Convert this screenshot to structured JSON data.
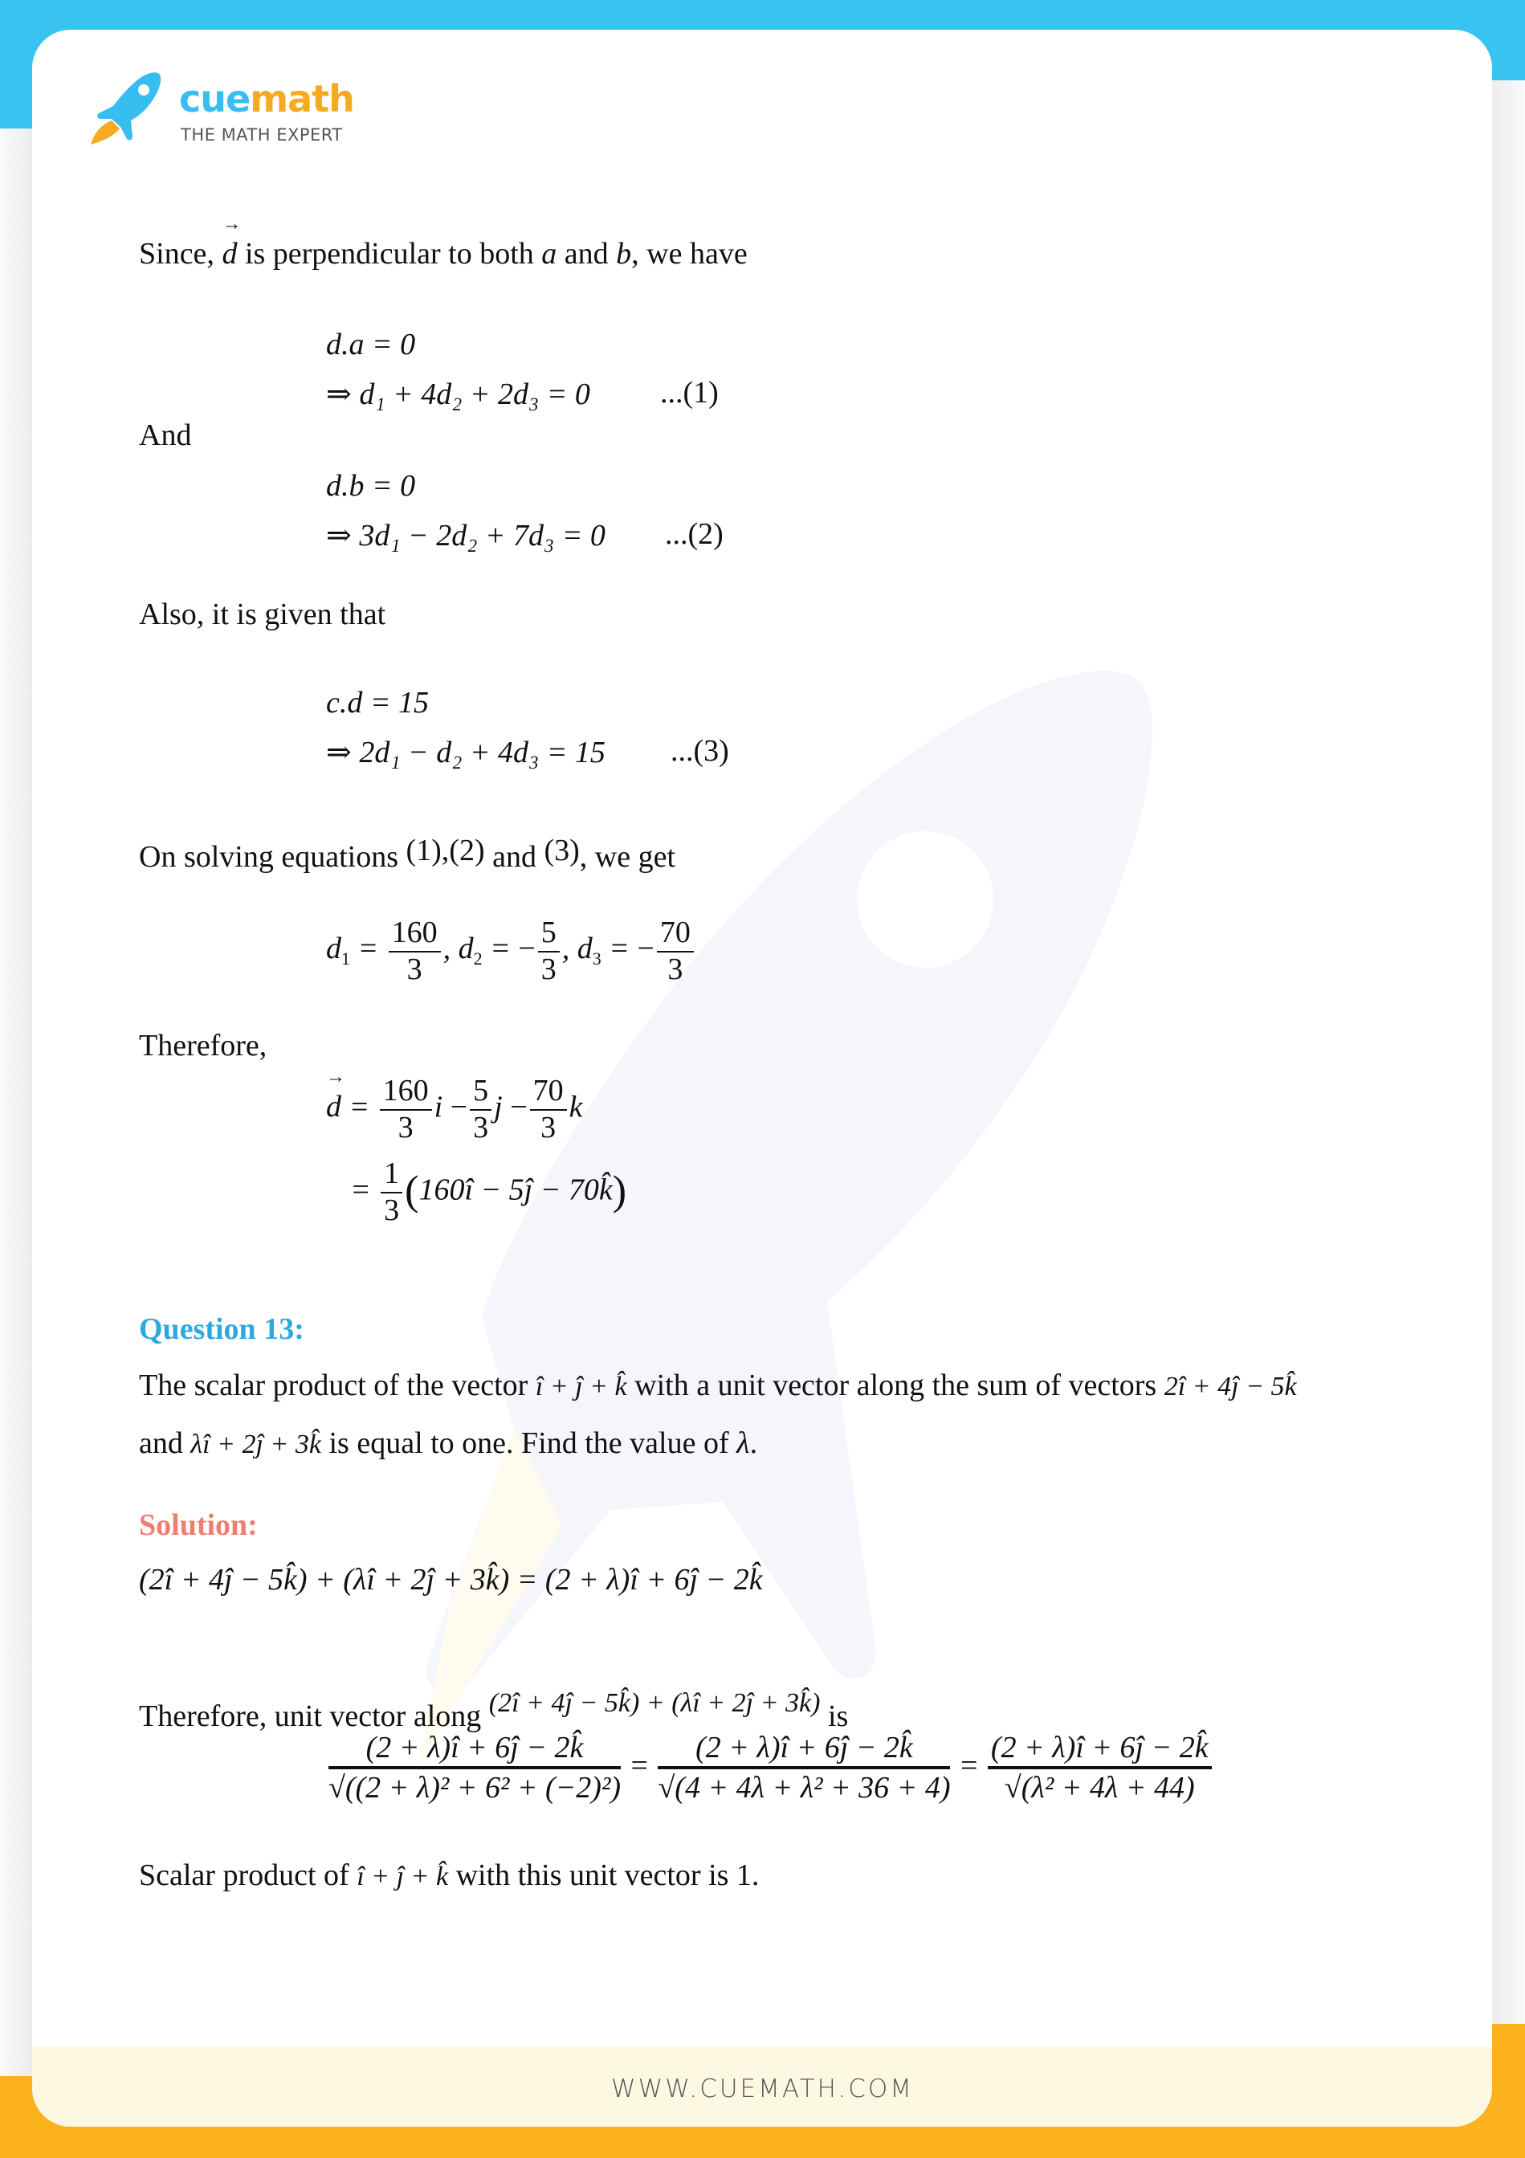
{
  "brand": {
    "name_part1": "cue",
    "name_part2": "math",
    "tagline": "THE MATH EXPERT",
    "footer_url": "WWW.CUEMATH.COM",
    "colors": {
      "blue": "#38c3f1",
      "orange": "#fbb21d",
      "question": "#2fa8e0",
      "solution": "#f07c72"
    }
  },
  "content": {
    "line_since": {
      "pre": "Since, ",
      "d": "d",
      "mid": " is perpendicular to both ",
      "a": "a",
      "and": " and ",
      "b": "b",
      "post": ", we have"
    },
    "eq_da": "d.a = 0",
    "eq_1": {
      "text": "⇒ d₁ + 4d₂ + 2d₃ = 0",
      "tag": "...(1)"
    },
    "and_label": "And",
    "eq_db": "d.b = 0",
    "eq_2": {
      "text": "⇒ 3d₁ − 2d₂ + 7d₃ = 0",
      "tag": "...(2)"
    },
    "also_label": "Also, it is given that",
    "eq_cd": "c.d = 15",
    "eq_3": {
      "text": "⇒ 2d₁ − d₂ + 4d₃ = 15",
      "tag": "...(3)"
    },
    "solving": {
      "pre": "On solving equations ",
      "refs": "(1),(2)",
      "and": " and ",
      "ref3": "(3)",
      "post": ", we get"
    },
    "solution_values": {
      "d1": {
        "label": "d",
        "sub": "1",
        "sign": "",
        "num": "160",
        "den": "3"
      },
      "d2": {
        "label": "d",
        "sub": "2",
        "sign": "−",
        "num": "5",
        "den": "3"
      },
      "d3": {
        "label": "d",
        "sub": "3",
        "sign": "−",
        "num": "70",
        "den": "3"
      }
    },
    "therefore_label": "Therefore,",
    "d_vector": {
      "lhs": "d",
      "terms": [
        {
          "sign": "",
          "num": "160",
          "den": "3",
          "unit": "i"
        },
        {
          "sign": "−",
          "num": "5",
          "den": "3",
          "unit": "j"
        },
        {
          "sign": "−",
          "num": "70",
          "den": "3",
          "unit": "k"
        }
      ],
      "factored": {
        "num": "1",
        "den": "3",
        "body": "160î − 5ĵ − 70k̂"
      }
    },
    "question": {
      "heading": "Question 13:",
      "line1_pre": "The scalar product of the vector ",
      "line1_vec": "î + ĵ + k̂",
      "line1_mid": " with a unit vector along the sum of vectors ",
      "line1_vec2": "2î + 4ĵ − 5k̂",
      "line2_pre": "and ",
      "line2_vec": "λî + 2ĵ + 3k̂",
      "line2_post": " is equal to one. Find the value of ",
      "line2_var": "λ",
      "line2_end": "."
    },
    "solution": {
      "heading": "Solution:",
      "sum_eq": "(2î + 4ĵ − 5k̂) + (λî + 2ĵ + 3k̂) = (2 + λ)î + 6ĵ − 2k̂",
      "unit_pre": "Therefore, unit vector along ",
      "unit_vec": "(2î + 4ĵ − 5k̂) + (λî + 2ĵ + 3k̂)",
      "unit_post": " is",
      "fractions": [
        {
          "num": "(2 + λ)î + 6ĵ − 2k̂",
          "den": "√((2 + λ)² + 6² + (−2)²)"
        },
        {
          "num": "(2 + λ)î + 6ĵ − 2k̂",
          "den": "√(4 + 4λ + λ² + 36 + 4)"
        },
        {
          "num": "(2 + λ)î + 6ĵ − 2k̂",
          "den": "√(λ² + 4λ + 44)"
        }
      ],
      "equals": "=",
      "scalar_pre": "Scalar product of ",
      "scalar_vec": "î + ĵ + k̂",
      "scalar_post": " with this unit vector is 1."
    }
  }
}
